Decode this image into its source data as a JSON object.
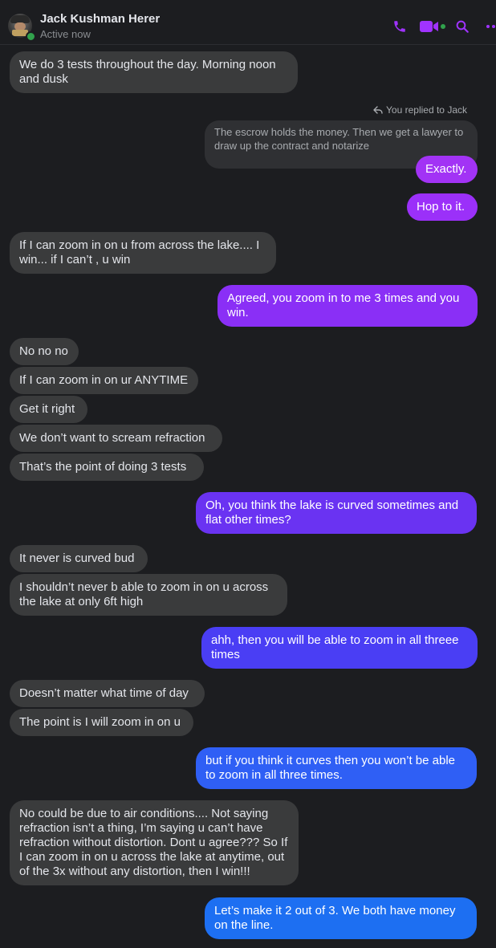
{
  "header": {
    "contact_name": "Jack Kushman Herer",
    "status": "Active now",
    "accent_color": "#a033ff"
  },
  "icons": [
    "phone-icon",
    "video-icon",
    "search-icon",
    "more-icon",
    "reply-arrow-icon"
  ],
  "reply": {
    "label": "You replied to Jack",
    "quoted_text": "The escrow holds the money. Then we get a lawyer to draw up the contract and notarize"
  },
  "messages": [
    {
      "from": "them",
      "text": "We do 3 tests throughout the day. Morning noon and dusk"
    },
    {
      "from": "me",
      "text": "Exactly."
    },
    {
      "from": "me",
      "text": "Hop to it."
    },
    {
      "from": "them",
      "text": "If I can zoom in on u from across the lake.... I win... if I can’t , u win"
    },
    {
      "from": "me",
      "text": "Agreed, you zoom in to me 3 times and you win."
    },
    {
      "from": "them",
      "text": "No no no"
    },
    {
      "from": "them",
      "text": "If I can zoom in on ur ANYTIME"
    },
    {
      "from": "them",
      "text": "Get it right"
    },
    {
      "from": "them",
      "text": "We don’t want to scream refraction"
    },
    {
      "from": "them",
      "text": "That’s the point of doing 3 tests"
    },
    {
      "from": "me",
      "text": "Oh, you think the lake is curved sometimes and flat other times?"
    },
    {
      "from": "them",
      "text": "It never is curved bud"
    },
    {
      "from": "them",
      "text": "I shouldn’t never b able to zoom in on u across the lake at only 6ft high"
    },
    {
      "from": "me",
      "text": "ahh, then you will be able to zoom in all threee times"
    },
    {
      "from": "them",
      "text": "Doesn’t matter what time of day"
    },
    {
      "from": "them",
      "text": "The point is I will zoom in on u"
    },
    {
      "from": "me",
      "text": "but if you think it curves then you won’t be able to zoom in all three times."
    },
    {
      "from": "them",
      "text": "No could be due to air conditions.... Not saying refraction isn’t a thing, I’m saying u can’t have refraction without distortion. Dont u agree??? So If I can zoom in on u across the lake at anytime, out of the 3x without any distortion, then I win!!!"
    },
    {
      "from": "me",
      "text": "Let’s make it 2 out of 3.  We both have money on the line."
    }
  ]
}
